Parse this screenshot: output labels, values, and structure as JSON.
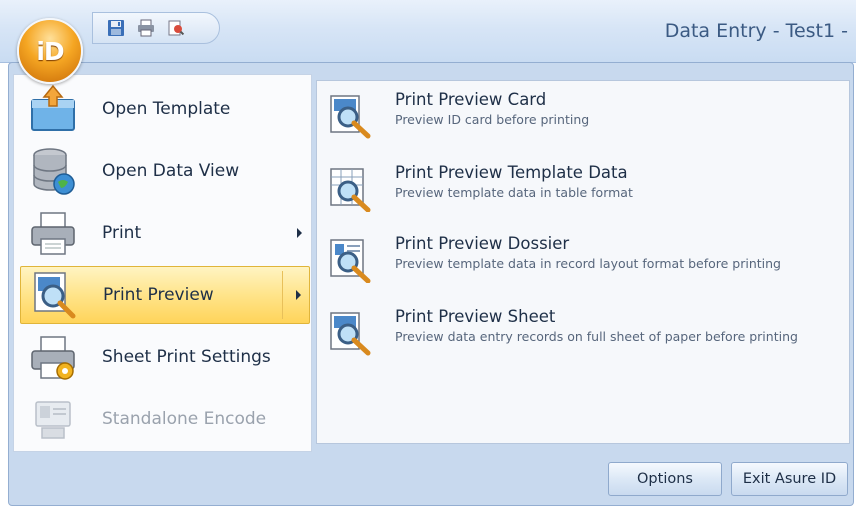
{
  "window": {
    "title": "Data Entry - Test1 -"
  },
  "app_button": {
    "label": "iD"
  },
  "quick_access": [
    "save-icon",
    "print-icon",
    "print-preview-icon"
  ],
  "menu": {
    "items": [
      {
        "label": "Open Template",
        "icon": "open-template-icon"
      },
      {
        "label": "Open Data View",
        "icon": "database-icon"
      },
      {
        "label": "Print",
        "icon": "printer-icon"
      },
      {
        "label": "Print Preview",
        "icon": "print-preview-icon"
      },
      {
        "label": "Sheet Print Settings",
        "icon": "sheet-print-settings-icon"
      },
      {
        "label": "Standalone Encode",
        "icon": "encode-icon"
      }
    ]
  },
  "submenu": {
    "items": [
      {
        "title": "Print Preview Card",
        "desc": "Preview ID card before printing"
      },
      {
        "title": "Print Preview Template Data",
        "desc": "Preview template data in table format"
      },
      {
        "title": "Print Preview Dossier",
        "desc": "Preview template data in record layout format before printing"
      },
      {
        "title": "Print Preview Sheet",
        "desc": "Preview data entry records on full sheet of paper before printing"
      }
    ]
  },
  "footer": {
    "options_label": "Options",
    "exit_label": "Exit Asure ID"
  },
  "colors": {
    "accent": "#ffd45a",
    "title_text": "#3b5a83",
    "frame": "#c8d9ee"
  }
}
